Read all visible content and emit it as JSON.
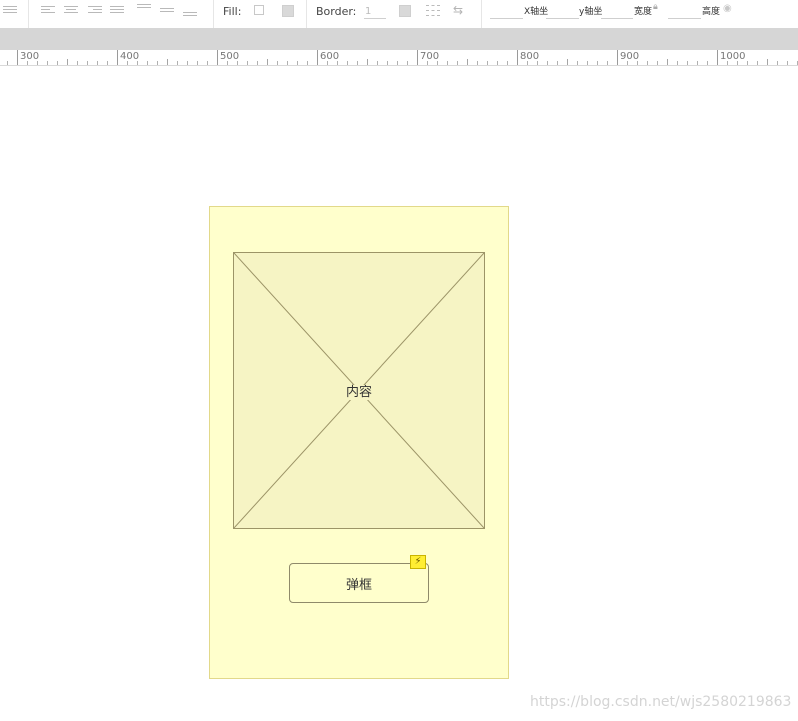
{
  "toolbar": {
    "fill_label": "Fill:",
    "border_label": "Border:",
    "border_width_value": "1",
    "x_label": "X轴坐",
    "y_label": "y轴坐",
    "width_label": "宽度",
    "height_label": "高度"
  },
  "ruler": {
    "labels": [
      "300",
      "400",
      "500",
      "600",
      "700",
      "800",
      "900",
      "1000"
    ]
  },
  "canvas": {
    "placeholder_label": "内容",
    "popup_button_label": "弹框",
    "event_badge_icon": "lightning-icon"
  },
  "watermark": "https://blog.csdn.net/wjs2580219863",
  "colors": {
    "screen_bg": "#ffffcc",
    "placeholder_bg": "#f6f4c4",
    "badge": "#ffee33"
  }
}
